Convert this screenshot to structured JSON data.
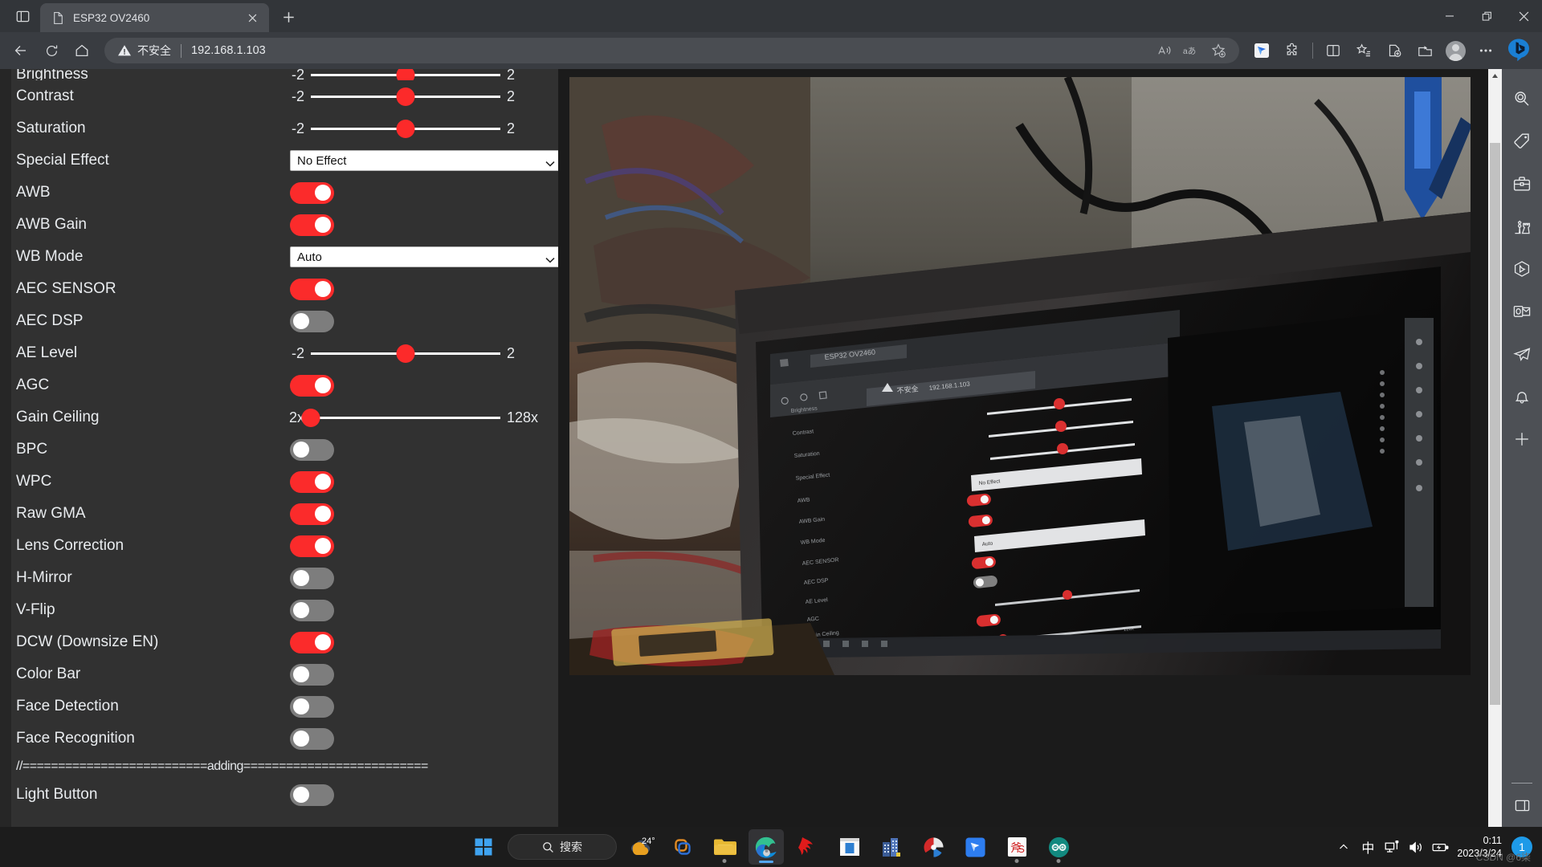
{
  "window": {
    "tab_title": "ESP32 OV2460",
    "minimize": "Minimize",
    "restore": "Restore",
    "close": "Close",
    "new_tab": "New tab",
    "tab_actions": "Tab actions menu"
  },
  "toolbar": {
    "back": "Back",
    "refresh": "Refresh",
    "home": "Home",
    "security_label": "不安全",
    "url": "192.168.1.103",
    "read_aloud": "Read aloud",
    "translate": "Translate",
    "add_favorite": "Add this page to favorites",
    "extension": "Extension",
    "extensions": "Extensions",
    "split_screen": "Split screen",
    "collections": "Collections",
    "browser_essentials": "Browser essentials",
    "downloads": "Downloads",
    "profile": "Profile",
    "settings_more": "Settings and more",
    "bing_chat": "Bing chat"
  },
  "edge_sidebar": {
    "items": [
      {
        "name": "search-icon",
        "label": "Search"
      },
      {
        "name": "shopping-tag-icon",
        "label": "Shopping"
      },
      {
        "name": "tools-icon",
        "label": "Tools"
      },
      {
        "name": "games-icon",
        "label": "Games"
      },
      {
        "name": "image-creator-icon",
        "label": "Image Creator"
      },
      {
        "name": "outlook-icon",
        "label": "Outlook"
      },
      {
        "name": "drop-icon",
        "label": "Drop"
      },
      {
        "name": "notifications-icon",
        "label": "Notifications"
      },
      {
        "name": "add-icon",
        "label": "Customize"
      }
    ],
    "toggle_label": "Toggle sidebar"
  },
  "camera_page": {
    "divider_text": "//==========================adding==========================",
    "rows": [
      {
        "label": "Brightness",
        "type": "slider",
        "min": "-2",
        "max": "2",
        "pos": 50,
        "partial": true
      },
      {
        "label": "Contrast",
        "type": "slider",
        "min": "-2",
        "max": "2",
        "pos": 50
      },
      {
        "label": "Saturation",
        "type": "slider",
        "min": "-2",
        "max": "2",
        "pos": 50
      },
      {
        "label": "Special Effect",
        "type": "select",
        "value": "No Effect"
      },
      {
        "label": "AWB",
        "type": "toggle",
        "state": "on"
      },
      {
        "label": "AWB Gain",
        "type": "toggle",
        "state": "on"
      },
      {
        "label": "WB Mode",
        "type": "select",
        "value": "Auto"
      },
      {
        "label": "AEC SENSOR",
        "type": "toggle",
        "state": "on"
      },
      {
        "label": "AEC DSP",
        "type": "toggle",
        "state": "off"
      },
      {
        "label": "AE Level",
        "type": "slider",
        "min": "-2",
        "max": "2",
        "pos": 50
      },
      {
        "label": "AGC",
        "type": "toggle",
        "state": "on"
      },
      {
        "label": "Gain Ceiling",
        "type": "slider",
        "min": "2x",
        "max": "128x",
        "pos": 0
      },
      {
        "label": "BPC",
        "type": "toggle",
        "state": "off"
      },
      {
        "label": "WPC",
        "type": "toggle",
        "state": "on"
      },
      {
        "label": "Raw GMA",
        "type": "toggle",
        "state": "on"
      },
      {
        "label": "Lens Correction",
        "type": "toggle",
        "state": "on"
      },
      {
        "label": "H-Mirror",
        "type": "toggle",
        "state": "off"
      },
      {
        "label": "V-Flip",
        "type": "toggle",
        "state": "off"
      },
      {
        "label": "DCW (Downsize EN)",
        "type": "toggle",
        "state": "on"
      },
      {
        "label": "Color Bar",
        "type": "toggle",
        "state": "off"
      },
      {
        "label": "Face Detection",
        "type": "toggle",
        "state": "off"
      },
      {
        "label": "Face Recognition",
        "type": "toggle",
        "state": "off"
      },
      {
        "label": "__DIVIDER__",
        "type": "divider"
      },
      {
        "label": "Light Button",
        "type": "toggle",
        "state": "off"
      }
    ],
    "stream_alt": "ESP32 camera live stream showing a monitor displaying this same page"
  },
  "taskbar": {
    "start": "Start",
    "search_placeholder": "搜索",
    "weather_temp": "24°",
    "items": [
      {
        "name": "taskbar-weather",
        "label": "Weather"
      },
      {
        "name": "taskbar-copilot",
        "label": "Copilot"
      },
      {
        "name": "taskbar-file-explorer",
        "label": "File Explorer"
      },
      {
        "name": "taskbar-edge",
        "label": "Microsoft Edge"
      },
      {
        "name": "taskbar-app-red",
        "label": "App"
      },
      {
        "name": "taskbar-app-window",
        "label": "App"
      },
      {
        "name": "taskbar-app-city",
        "label": "App"
      },
      {
        "name": "taskbar-app-disc",
        "label": "App"
      },
      {
        "name": "taskbar-app-blue",
        "label": "App"
      },
      {
        "name": "taskbar-app-ks",
        "label": "App"
      },
      {
        "name": "taskbar-arduino",
        "label": "Arduino IDE"
      }
    ],
    "tray": {
      "show_hidden": "Show hidden icons",
      "ime": "中",
      "network": "Network",
      "volume": "Volume",
      "battery": "Battery",
      "time": "0:11",
      "date": "2023/3/24",
      "notification_count": "1"
    },
    "watermark": "CSDN @6柒"
  },
  "colors": {
    "accent_red": "#fb2b2b",
    "toggle_off": "#7d7d7d",
    "page_bg": "#313131",
    "chrome_bg": "#393c41",
    "sidebar_bg": "#4d5055"
  }
}
